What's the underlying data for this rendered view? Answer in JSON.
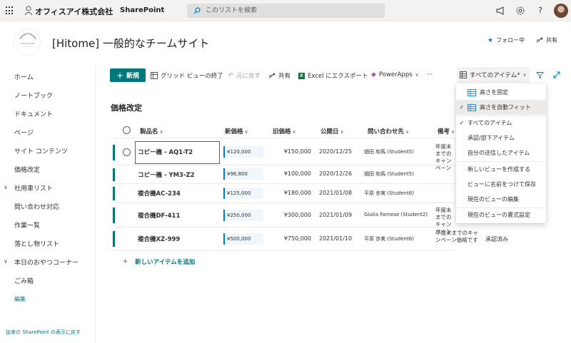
{
  "suitebar": {
    "org_name": "オフィスアイ株式会社",
    "app_name": "SharePoint",
    "search_placeholder": "このリストを検索"
  },
  "site": {
    "title": "[Hitome] 一般的なチームサイト",
    "follow_label": "フォロー中",
    "share_label": "共有"
  },
  "leftnav": {
    "items": [
      "ホーム",
      "ノートブック",
      "ドキュメント",
      "ページ",
      "サイト コンテンツ",
      "価格改定",
      "社用車リスト",
      "問い合わせ対応",
      "作業一覧",
      "落とし物リスト",
      "本日のおやつコーナー",
      "ごみ箱"
    ],
    "edit_label": "編集",
    "classic_link": "従来の SharePoint の表示に戻す"
  },
  "commandbar": {
    "new_label": "新規",
    "grid_exit": "グリッド ビューの終了",
    "undo": "元に戻す",
    "share": "共有",
    "export": "Excel にエクスポート",
    "powerapps": "PowerApps",
    "more": "···",
    "view_selector": "すべてのアイテム*"
  },
  "list": {
    "title": "価格改定",
    "columns": [
      "製品名",
      "新価格",
      "旧価格",
      "公開日",
      "問い合わせ先",
      "備考"
    ],
    "rows": [
      {
        "name": "コピー機 - AQ1-T2",
        "new_price": "¥120,000",
        "old_price": "¥150,000",
        "date": "2020/12/25",
        "contact": "畑田 和馬 (Student5)",
        "note": "年度末までのキャンペーン",
        "status": ""
      },
      {
        "name": "コピー機 - YM3-Z2",
        "new_price": "¥96,800",
        "old_price": "¥100,000",
        "date": "2020/12/26",
        "contact": "畑田 和馬 (Student5)",
        "note": "",
        "status": ""
      },
      {
        "name": "複合機AC-234",
        "new_price": "¥125,000",
        "old_price": "¥180,000",
        "date": "2021/01/08",
        "contact": "平原 歩実 (Student6)",
        "note": "",
        "status": ""
      },
      {
        "name": "複合機DF-411",
        "new_price": "¥250,000",
        "old_price": "¥300,000",
        "date": "2021/01/09",
        "contact": "Giulia Farnese (Student2)",
        "note": "年度末までのキャンペーン",
        "status": ""
      },
      {
        "name": "複合機XZ-999",
        "new_price": "¥500,000",
        "old_price": "¥750,000",
        "date": "2021/01/10",
        "contact": "平原 歩実 (Student6)",
        "note": "年度末までのキャンペーン価格です",
        "status": "承認済み"
      }
    ],
    "add_item": "新しいアイテムを追加"
  },
  "view_menu": {
    "items": [
      {
        "label": "高さを固定",
        "icon": "grid-icon",
        "checked": false
      },
      {
        "label": "高さを自動フィット",
        "icon": "grid-icon",
        "checked": true
      },
      {
        "label": "すべてのアイテム",
        "checked": true
      },
      {
        "label": "承認/部下アイテム",
        "checked": false
      },
      {
        "label": "自分の送信したアイテム",
        "checked": false
      },
      {
        "label": "新しいビューを作成する",
        "checked": false
      },
      {
        "label": "ビューに名前をつけて保存",
        "checked": false
      },
      {
        "label": "現在のビューの編集",
        "checked": false
      },
      {
        "label": "現在のビューの書式設定",
        "checked": false
      }
    ]
  },
  "colors": {
    "accent": "#03787c",
    "suitebar_bg": "#f3f2f1",
    "focus_blue": "#0078d4"
  }
}
